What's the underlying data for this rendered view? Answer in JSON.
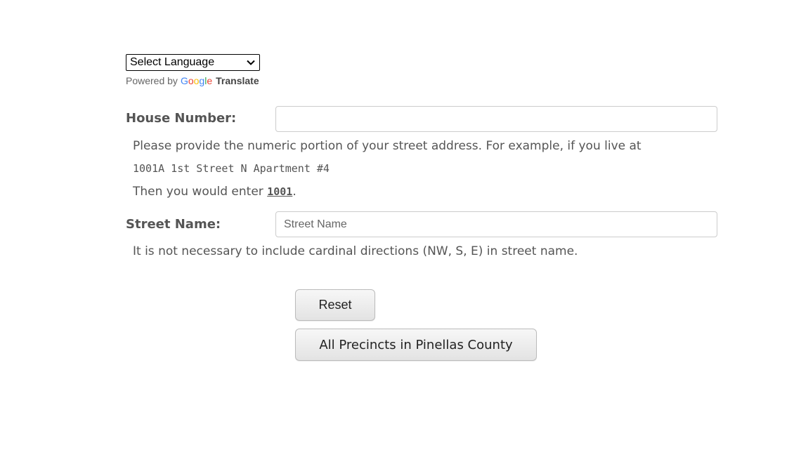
{
  "translate": {
    "select_label": "Select Language",
    "chevron_icon": "chevron-down-icon",
    "powered_by": "Powered by",
    "google_letters": [
      "G",
      "o",
      "o",
      "g",
      "l",
      "e"
    ],
    "google_colors": [
      "#4285f4",
      "#ea4335",
      "#fbbc05",
      "#4285f4",
      "#34a853",
      "#ea4335"
    ],
    "translate_label": "Translate"
  },
  "form": {
    "house_number": {
      "label": "House Number:",
      "value": "",
      "placeholder": ""
    },
    "house_help": {
      "line1": "Please provide the numeric portion of your street address. For example, if you live at",
      "example_address": "1001A 1st Street N Apartment #4",
      "line3_prefix": "Then you would enter ",
      "line3_code": "1001",
      "line3_suffix": "."
    },
    "street_name": {
      "label": "Street Name:",
      "value": "",
      "placeholder": "Street Name"
    },
    "street_help": "It is not necessary to include cardinal directions (NW, S, E) in street name."
  },
  "buttons": {
    "reset_label": "Reset",
    "all_precincts_label": "All Precincts in Pinellas County"
  }
}
